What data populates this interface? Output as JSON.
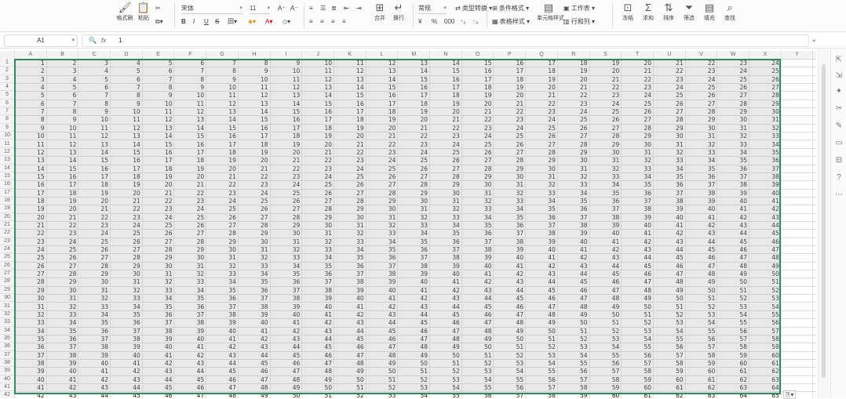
{
  "ribbon": {
    "paste": "格式刷",
    "clipboard_paste": "粘贴",
    "font_name": "宋体",
    "font_size": "11",
    "font_grow": "A⁺",
    "font_shrink": "A⁻",
    "bold": "B",
    "italic": "I",
    "underline": "U",
    "strike": "S",
    "font_color_label": "A",
    "merge_label": "合并",
    "wrap_label": "换行",
    "number_format": "常规",
    "currency_label": "¥",
    "percent_label": "%",
    "thousands_label": "000",
    "type_convert": "类型转换",
    "cond_format": "条件格式",
    "table_style": "表格样式",
    "cell_style": "单元格样式",
    "sum_label": "求和",
    "filter_label": "筛选",
    "sort_label": "排序",
    "fill_label": "填充",
    "row_col_label": "行和列",
    "sheet_label": "工作表",
    "freeze_label": "冻结",
    "find_label": "查找"
  },
  "formula_bar": {
    "name_box": "A1",
    "fx_symbol": "fx",
    "formula_value": "1"
  },
  "columns": [
    "A",
    "B",
    "C",
    "D",
    "E",
    "F",
    "G",
    "H",
    "I",
    "J",
    "K",
    "L",
    "M",
    "N",
    "O",
    "P",
    "Q",
    "R",
    "S",
    "T",
    "U",
    "V",
    "W",
    "X",
    "Y"
  ],
  "rows": [
    "1",
    "2",
    "3",
    "4",
    "5",
    "6",
    "7",
    "8",
    "9",
    "10",
    "11",
    "12",
    "13",
    "14",
    "15",
    "16",
    "17",
    "18",
    "19",
    "20",
    "21",
    "22",
    "23",
    "24",
    "25",
    "26",
    "27",
    "28",
    "29",
    "30",
    "31",
    "32",
    "33",
    "34",
    "35",
    "36",
    "37",
    "38",
    "39",
    "40",
    "41",
    "42"
  ],
  "sheet_rule": "cell(row r, column c) = r + c - 1",
  "paste_options": "⎘▾"
}
